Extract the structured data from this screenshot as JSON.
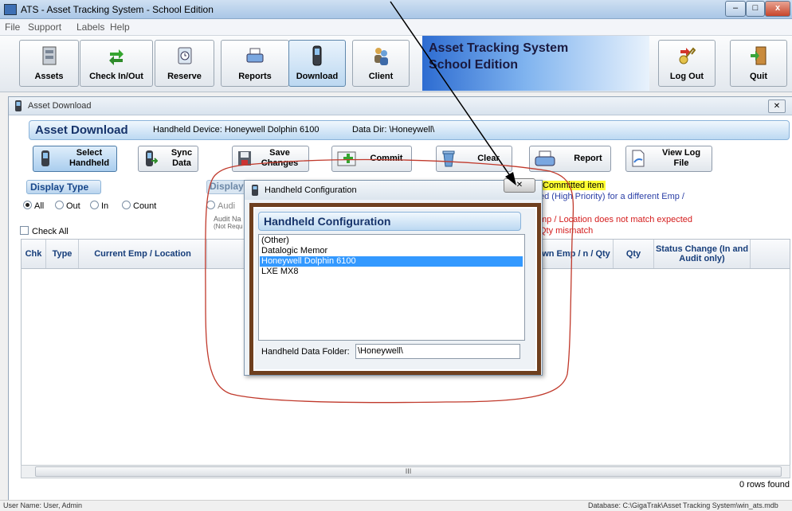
{
  "window": {
    "title": "ATS - Asset Tracking System - School Edition",
    "minimize": "–",
    "maximize": "□",
    "close": "x"
  },
  "menu": [
    "File",
    "Support",
    "Labels",
    "Help"
  ],
  "toolbar": {
    "buttons": [
      "Assets",
      "Check In/Out",
      "Reserve",
      "Reports",
      "Download",
      "Client"
    ],
    "banner_line1": "Asset Tracking System",
    "banner_line2": "School Edition",
    "logout": "Log Out",
    "quit": "Quit"
  },
  "child": {
    "title": "Asset Download",
    "close": "✕",
    "header": "Asset Download",
    "device_label": "Handheld Device:  Honeywell Dolphin 6100",
    "datadir_label": "Data Dir:  \\Honeywell\\",
    "actions": {
      "select_handheld": [
        "Select",
        "Handheld"
      ],
      "sync_data": [
        "Sync",
        "Data"
      ],
      "save_changes": [
        "Save",
        "Changes"
      ],
      "commit": "Commit",
      "clear": "Clear",
      "report": "Report",
      "view_log": [
        "View Log",
        "File"
      ]
    },
    "display_type": {
      "label": "Display Type",
      "options": [
        "All",
        "Out",
        "In",
        "Count"
      ],
      "selected": "All",
      "check_all": "Check All"
    },
    "display2": {
      "label": "Display",
      "audit": "Audi",
      "audit_name": "Audit Na",
      "audit_req": "(Not Requ"
    },
    "legend": {
      "committed": "Committed item",
      "high_priority": "ed (High Priority) for a different Emp /",
      "mismatch": "mp / Location does not match expected",
      "qty": "Qty mismatch"
    },
    "columns": [
      "Chk",
      "Type",
      "Current Emp / Location",
      "wn Emp / n / Qty",
      "Qty",
      "Status Change (In and Audit only)"
    ],
    "scroll_label": "III",
    "rows_found": "0 rows found"
  },
  "dialog": {
    "title": "Handheld Configuration",
    "header": "Handheld Configuration",
    "devices": [
      "(Other)",
      "Datalogic Memor",
      "Honeywell Dolphin 6100",
      "LXE MX8"
    ],
    "selected_device": "Honeywell Dolphin 6100",
    "folder_label": "Handheld Data Folder:",
    "folder_value": "\\Honeywell\\",
    "close": "✕"
  },
  "statusbar": {
    "user": "User Name:  User, Admin",
    "database": "Database:  C:\\GigaTrak\\Asset Tracking System\\win_ats.mdb"
  }
}
